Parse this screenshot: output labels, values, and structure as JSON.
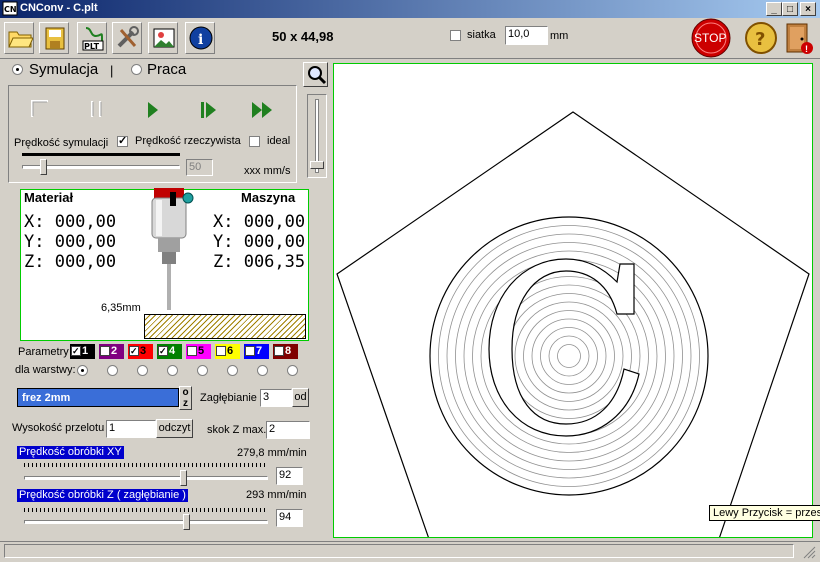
{
  "window": {
    "title": "CNConv - C.plt"
  },
  "toolbar": {
    "dimensions": "50 x 44,98",
    "grid_label": "siatka",
    "grid_value": "10,0",
    "grid_unit": "mm",
    "stop_label": "STOP",
    "tools": [
      "open-folder-icon",
      "save-icon",
      "plt-file-icon",
      "tools-icon",
      "image-icon",
      "info-icon"
    ]
  },
  "mode": {
    "simulation": "Symulacja",
    "work": "Praca",
    "separator": "|"
  },
  "simulation": {
    "speed_label": "Prędkość symulacji",
    "realspeed_label": "Prędkość rzeczywista",
    "ideal_label": "ideal",
    "speed_value": "50",
    "units": "xxx  mm/s",
    "speed_fraction": 0.12
  },
  "machine": {
    "material_label": "Materiał",
    "machine_label": "Maszyna",
    "material": [
      "X: 000,00",
      "Y: 000,00",
      "Z: 000,00"
    ],
    "machine_coords": [
      "X: 000,00",
      "Y: 000,00",
      "Z: 006,35"
    ],
    "tool_diameter": "6,35mm"
  },
  "layers": {
    "label": "Parametry",
    "for_layers": "dla warstwy:",
    "items": [
      {
        "num": "1",
        "color": "#000000",
        "checked": true
      },
      {
        "num": "2",
        "color": "#800080",
        "checked": false
      },
      {
        "num": "3",
        "color": "#ff0000",
        "checked": true
      },
      {
        "num": "4",
        "color": "#008000",
        "checked": true
      },
      {
        "num": "5",
        "color": "#ff00ff",
        "checked": false
      },
      {
        "num": "6",
        "color": "#ffff00",
        "checked": false
      },
      {
        "num": "7",
        "color": "#0000ff",
        "checked": false
      },
      {
        "num": "8",
        "color": "#800000",
        "checked": false
      }
    ]
  },
  "tool": {
    "name": "frez 2mm",
    "oz_label": "o z",
    "plunge_label": "Zagłębianie",
    "plunge_value": "3",
    "od_label": "od",
    "retract_label": "Wysokość przelotu",
    "retract_value": "1",
    "read_label": "odczyt",
    "zstep_label": "skok Z max.",
    "zstep_value": "2"
  },
  "feeds": {
    "xy_label": "Prędkość obróbki XY",
    "xy_value": "279,8 mm/min",
    "xy_percent": "92",
    "xy_fraction": 0.66,
    "z_label": "Prędkość obróbki Z  ( zagłębianie )",
    "z_value": "293 mm/min",
    "z_percent": "94",
    "z_fraction": 0.67
  },
  "status": {
    "tooltip": "Lewy Przycisk = przesu"
  },
  "colors": {
    "titlebar": "#0a246a",
    "frame_green": "#00cc00",
    "selection_blue": "#0000cc",
    "stop_red": "#cc0000"
  }
}
